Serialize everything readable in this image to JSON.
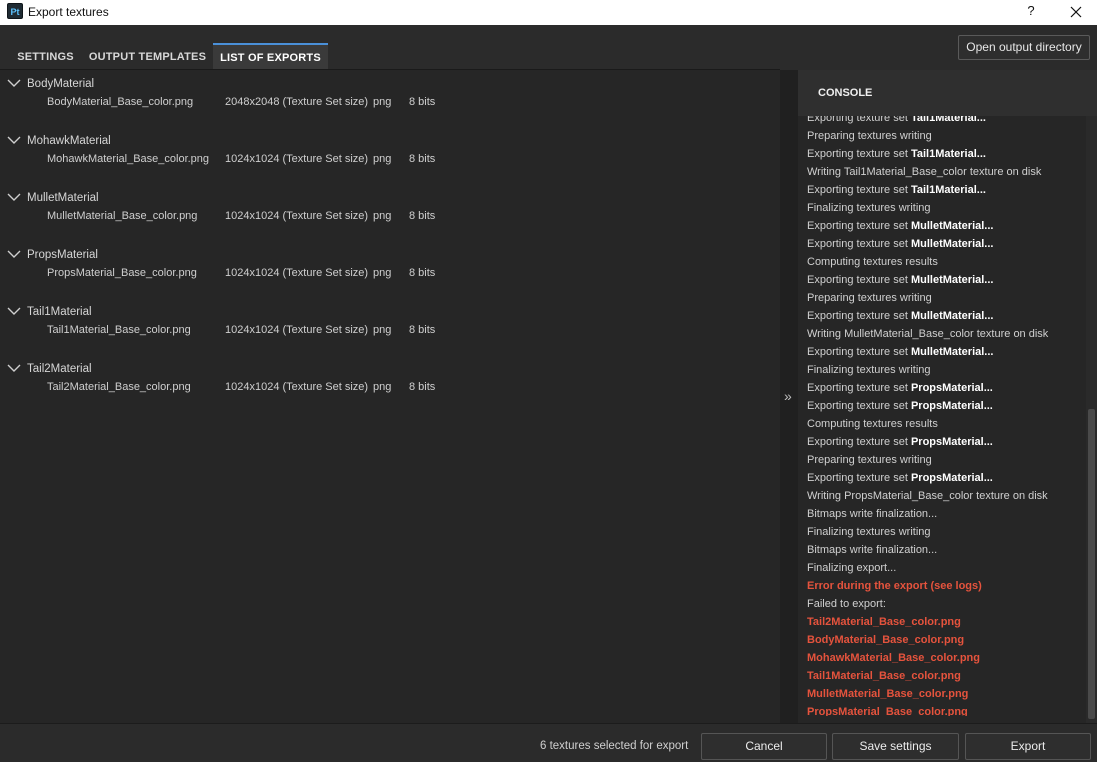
{
  "window": {
    "title": "Export textures",
    "logo_text": "Pt",
    "help_label": "?"
  },
  "tabs": [
    {
      "label": "SETTINGS"
    },
    {
      "label": "OUTPUT TEMPLATES"
    },
    {
      "label": "LIST OF EXPORTS"
    }
  ],
  "active_tab": "LIST OF EXPORTS",
  "toolbar": {
    "open_output_directory": "Open output directory"
  },
  "exports": [
    {
      "material": "BodyMaterial",
      "file": "BodyMaterial_Base_color.png",
      "size": "2048x2048 (Texture Set size)",
      "format": "png",
      "bits": "8 bits"
    },
    {
      "material": "MohawkMaterial",
      "file": "MohawkMaterial_Base_color.png",
      "size": "1024x1024 (Texture Set size)",
      "format": "png",
      "bits": "8 bits"
    },
    {
      "material": "MulletMaterial",
      "file": "MulletMaterial_Base_color.png",
      "size": "1024x1024 (Texture Set size)",
      "format": "png",
      "bits": "8 bits"
    },
    {
      "material": "PropsMaterial",
      "file": "PropsMaterial_Base_color.png",
      "size": "1024x1024 (Texture Set size)",
      "format": "png",
      "bits": "8 bits"
    },
    {
      "material": "Tail1Material",
      "file": "Tail1Material_Base_color.png",
      "size": "1024x1024 (Texture Set size)",
      "format": "png",
      "bits": "8 bits"
    },
    {
      "material": "Tail2Material",
      "file": "Tail2Material_Base_color.png",
      "size": "1024x1024 (Texture Set size)",
      "format": "png",
      "bits": "8 bits"
    }
  ],
  "splitter_glyph": "»",
  "console": {
    "title": "CONSOLE",
    "lines": [
      {
        "text": "Exporting texture set ",
        "bold": "Tail1Material...",
        "type": "normal"
      },
      {
        "text": "Preparing textures writing",
        "bold": "",
        "type": "normal"
      },
      {
        "text": "Exporting texture set ",
        "bold": "Tail1Material...",
        "type": "normal"
      },
      {
        "text": "Writing Tail1Material_Base_color texture on disk",
        "bold": "",
        "type": "normal"
      },
      {
        "text": "Exporting texture set ",
        "bold": "Tail1Material...",
        "type": "normal"
      },
      {
        "text": "Finalizing textures writing",
        "bold": "",
        "type": "normal"
      },
      {
        "text": "Exporting texture set ",
        "bold": "MulletMaterial...",
        "type": "normal"
      },
      {
        "text": "Exporting texture set ",
        "bold": "MulletMaterial...",
        "type": "normal"
      },
      {
        "text": "Computing textures results",
        "bold": "",
        "type": "normal"
      },
      {
        "text": "Exporting texture set ",
        "bold": "MulletMaterial...",
        "type": "normal"
      },
      {
        "text": "Preparing textures writing",
        "bold": "",
        "type": "normal"
      },
      {
        "text": "Exporting texture set ",
        "bold": "MulletMaterial...",
        "type": "normal"
      },
      {
        "text": "Writing MulletMaterial_Base_color texture on disk",
        "bold": "",
        "type": "normal"
      },
      {
        "text": "Exporting texture set ",
        "bold": "MulletMaterial...",
        "type": "normal"
      },
      {
        "text": "Finalizing textures writing",
        "bold": "",
        "type": "normal"
      },
      {
        "text": "Exporting texture set ",
        "bold": "PropsMaterial...",
        "type": "normal"
      },
      {
        "text": "Exporting texture set ",
        "bold": "PropsMaterial...",
        "type": "normal"
      },
      {
        "text": "Computing textures results",
        "bold": "",
        "type": "normal"
      },
      {
        "text": "Exporting texture set ",
        "bold": "PropsMaterial...",
        "type": "normal"
      },
      {
        "text": "Preparing textures writing",
        "bold": "",
        "type": "normal"
      },
      {
        "text": "Exporting texture set ",
        "bold": "PropsMaterial...",
        "type": "normal"
      },
      {
        "text": "Writing PropsMaterial_Base_color texture on disk",
        "bold": "",
        "type": "normal"
      },
      {
        "text": "Bitmaps write finalization...",
        "bold": "",
        "type": "normal"
      },
      {
        "text": "Finalizing textures writing",
        "bold": "",
        "type": "normal"
      },
      {
        "text": "Bitmaps write finalization...",
        "bold": "",
        "type": "normal"
      },
      {
        "text": "Finalizing export...",
        "bold": "",
        "type": "normal"
      },
      {
        "text": "Error during the export (see logs)",
        "bold": "",
        "type": "error"
      },
      {
        "text": "Failed to export:",
        "bold": "",
        "type": "normal"
      },
      {
        "text": "Tail2Material_Base_color.png",
        "bold": "",
        "type": "error"
      },
      {
        "text": "BodyMaterial_Base_color.png",
        "bold": "",
        "type": "error"
      },
      {
        "text": "MohawkMaterial_Base_color.png",
        "bold": "",
        "type": "error"
      },
      {
        "text": "Tail1Material_Base_color.png",
        "bold": "",
        "type": "error"
      },
      {
        "text": "MulletMaterial_Base_color.png",
        "bold": "",
        "type": "error"
      },
      {
        "text": "PropsMaterial_Base_color.png",
        "bold": "",
        "type": "error"
      }
    ]
  },
  "footer": {
    "status": "6 textures selected for export",
    "cancel_label": "Cancel",
    "save_label": "Save settings",
    "export_label": "Export"
  },
  "colors": {
    "error_text": "#e5533d",
    "active_tab_accent": "#4a90d9"
  }
}
